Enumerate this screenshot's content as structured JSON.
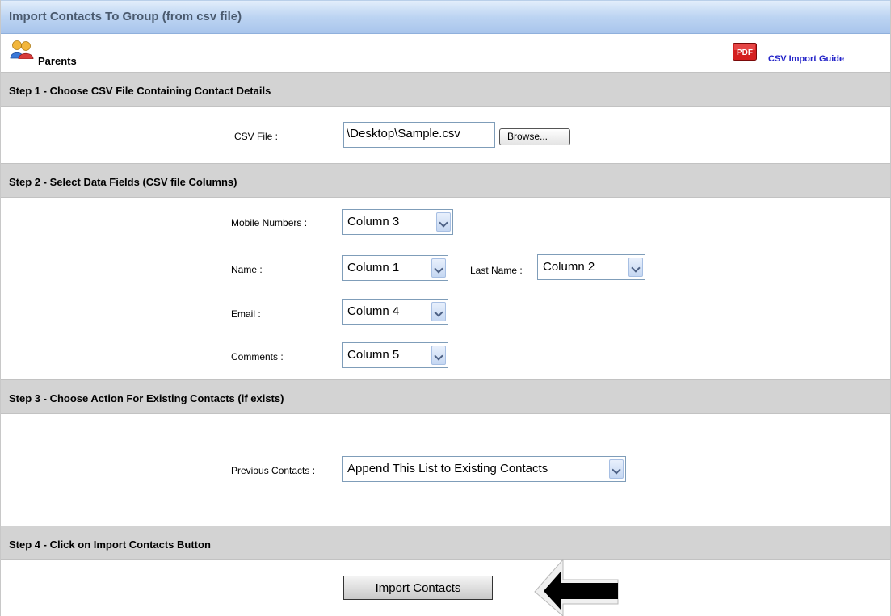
{
  "window": {
    "title": "Import Contacts To Group (from csv file)"
  },
  "group": {
    "name": "Parents",
    "icon": "users-icon"
  },
  "guide": {
    "label": "CSV Import Guide",
    "icon": "pdf-icon",
    "pdf_text": "PDF"
  },
  "step1": {
    "header": "Step 1 - Choose CSV File Containing Contact Details",
    "file_label": "CSV File :",
    "file_value": "\\Desktop\\Sample.csv",
    "browse_label": "Browse..."
  },
  "step2": {
    "header": "Step 2 - Select Data Fields (CSV file Columns)",
    "mobile_label": "Mobile Numbers :",
    "mobile_value": "Column 3",
    "name_label": "Name :",
    "name_value": "Column 1",
    "last_name_label": "Last Name :",
    "last_name_value": "Column 2",
    "email_label": "Email :",
    "email_value": "Column 4",
    "comments_label": "Comments :",
    "comments_value": "Column 5"
  },
  "step3": {
    "header": "Step 3 - Choose Action For Existing Contacts (if exists)",
    "previous_label": "Previous Contacts :",
    "previous_value": "Append This List to Existing Contacts"
  },
  "step4": {
    "header": "Step 4 - Click on Import Contacts Button",
    "import_label": "Import Contacts"
  },
  "colors": {
    "title_bar": "#bcd4f2",
    "step_header": "#d3d3d3",
    "link": "#2323c8"
  }
}
